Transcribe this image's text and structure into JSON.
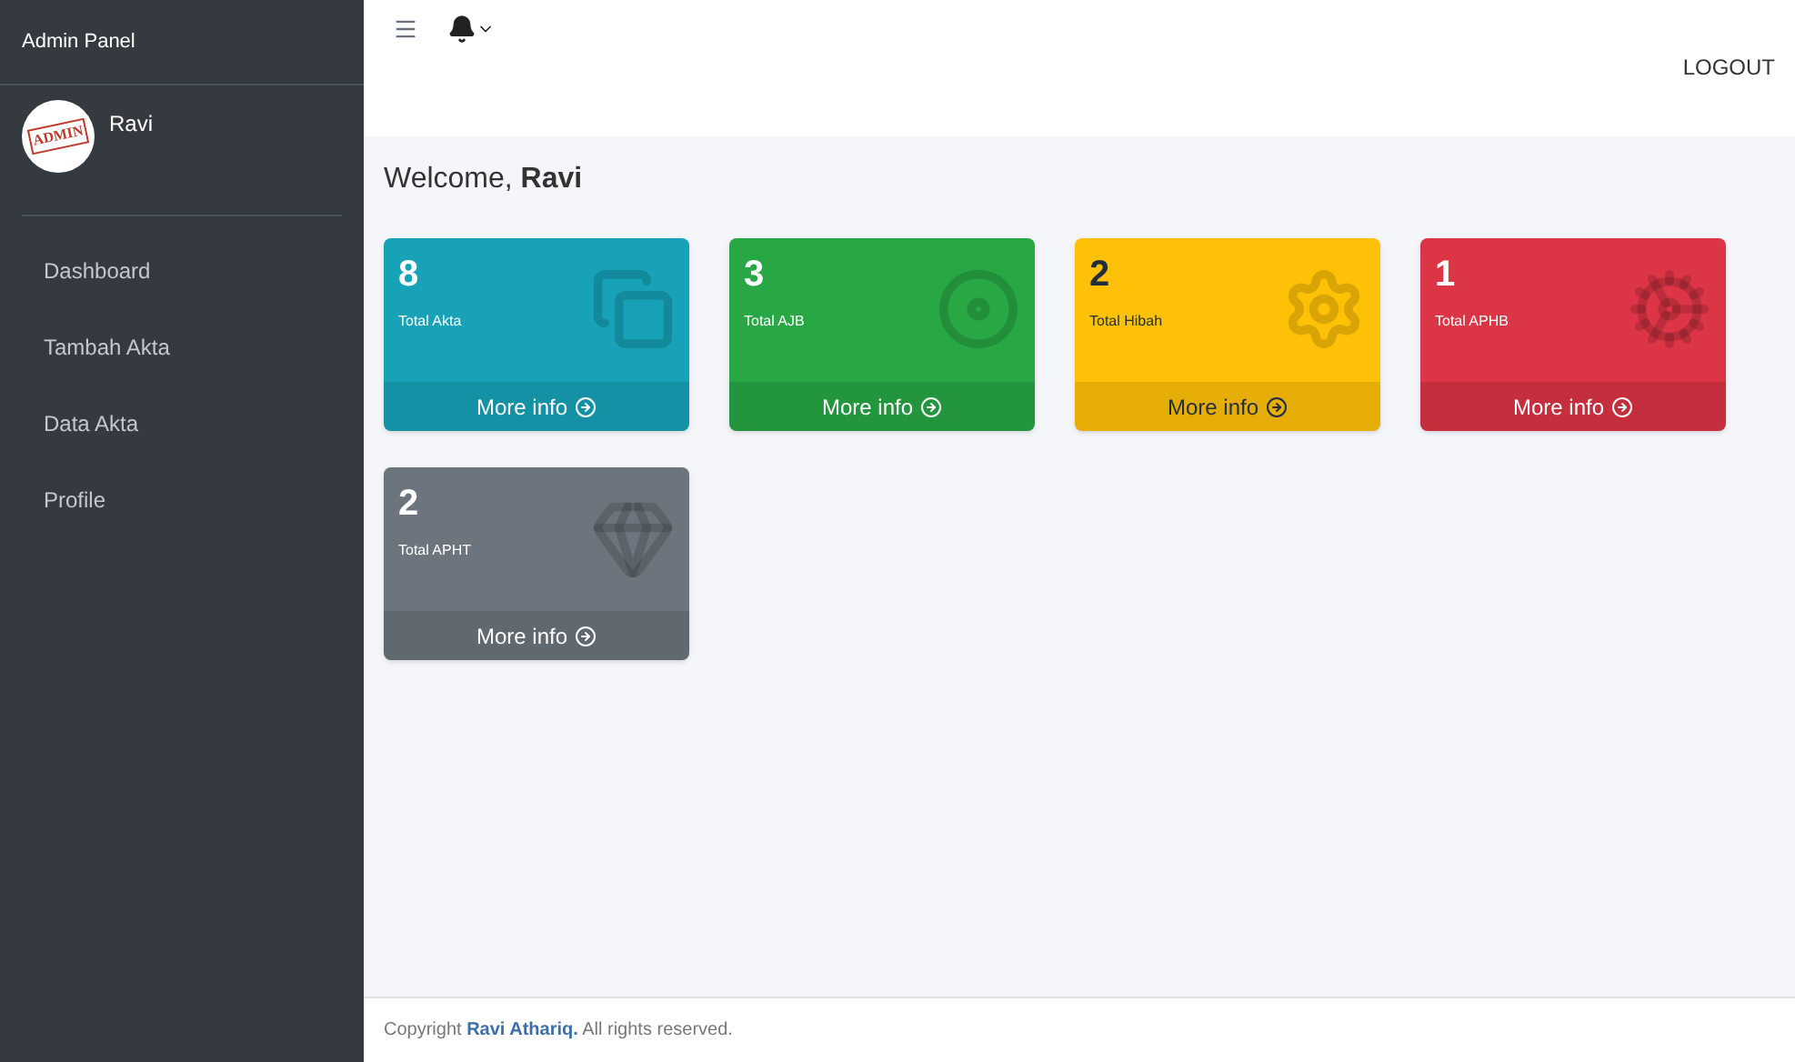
{
  "sidebar": {
    "brand": "Admin Panel",
    "user": {
      "avatar_text": "ADMIN",
      "name": "Ravi"
    },
    "items": [
      {
        "label": "Dashboard"
      },
      {
        "label": "Tambah Akta"
      },
      {
        "label": "Data Akta"
      },
      {
        "label": "Profile"
      }
    ]
  },
  "topbar": {
    "logout": "LOGOUT"
  },
  "welcome": {
    "text": "Welcome, ",
    "name": "Ravi"
  },
  "cards": [
    {
      "count": "8",
      "label": "Total Akta",
      "link": "More info",
      "color": "#17a2b8",
      "kind": "copy"
    },
    {
      "count": "3",
      "label": "Total AJB",
      "link": "More info",
      "color": "#28a745",
      "kind": "disc"
    },
    {
      "count": "2",
      "label": "Total Hibah",
      "link": "More info",
      "color": "#ffc107",
      "kind": "gear"
    },
    {
      "count": "1",
      "label": "Total APHB",
      "link": "More info",
      "color": "#dc3545",
      "kind": "cog"
    },
    {
      "count": "2",
      "label": "Total APHT",
      "link": "More info",
      "color": "#6c757d",
      "kind": "gem"
    }
  ],
  "footer": {
    "before": "Copyright ",
    "link": "Ravi Athariq.",
    "after": " All rights reserved."
  }
}
